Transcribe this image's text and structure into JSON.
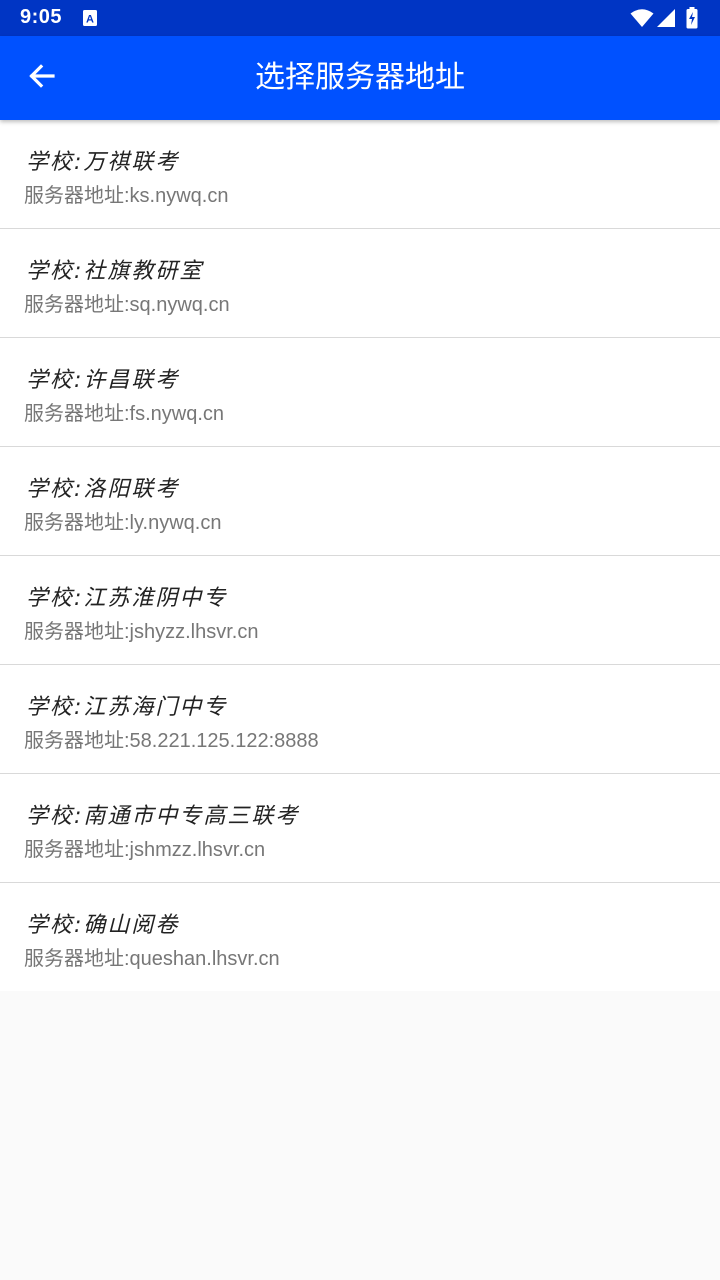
{
  "status_bar": {
    "time": "9:05",
    "app_icon": "a-notification-icon",
    "wifi_icon": "wifi-icon",
    "signal_icon": "cell-signal-icon",
    "battery_icon": "battery-charging-icon"
  },
  "app_bar": {
    "back_icon": "arrow-back-icon",
    "title": "选择服务器地址",
    "color": "#0051ff"
  },
  "servers": [
    {
      "school": "学校:万祺联考",
      "address": "服务器地址:ks.nywq.cn"
    },
    {
      "school": "学校:社旗教研室",
      "address": "服务器地址:sq.nywq.cn"
    },
    {
      "school": "学校:许昌联考",
      "address": "服务器地址:fs.nywq.cn"
    },
    {
      "school": "学校:洛阳联考",
      "address": "服务器地址:ly.nywq.cn"
    },
    {
      "school": "学校:江苏淮阴中专",
      "address": "服务器地址:jshyzz.lhsvr.cn"
    },
    {
      "school": "学校:江苏海门中专",
      "address": "服务器地址:58.221.125.122:8888"
    },
    {
      "school": "学校:南通市中专高三联考",
      "address": "服务器地址:jshmzz.lhsvr.cn"
    },
    {
      "school": "学校:确山阅卷",
      "address": "服务器地址:queshan.lhsvr.cn"
    }
  ]
}
